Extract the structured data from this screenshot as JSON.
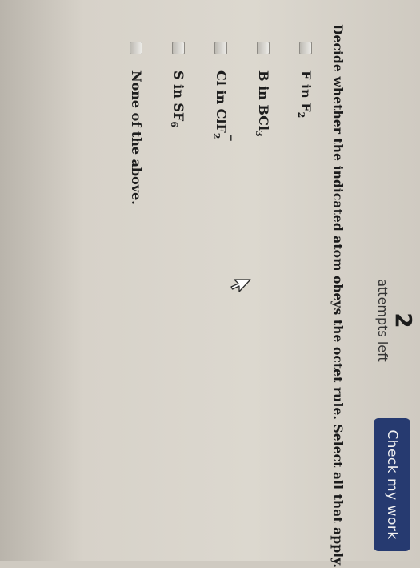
{
  "header": {
    "attempts_count": "2",
    "attempts_label": "attempts left",
    "check_button_label": "Check my work"
  },
  "question": {
    "prompt": "Decide whether the indicated atom obeys the octet rule. Select all that apply."
  },
  "options": [
    {
      "prefix": "F in F",
      "sub": "2",
      "sub_after": "",
      "sup": "",
      "checked": false
    },
    {
      "prefix": "B in BCl",
      "sub": "3",
      "sub_after": "",
      "sup": "",
      "checked": false
    },
    {
      "prefix": "Cl in ClF",
      "sub": "2",
      "sub_after": "",
      "sup": "−",
      "checked": false
    },
    {
      "prefix": "S in SF",
      "sub": "6",
      "sub_after": "",
      "sup": "",
      "checked": false
    },
    {
      "prefix": "None of the above.",
      "sub": "",
      "sub_after": "",
      "sup": "",
      "checked": false
    }
  ],
  "colors": {
    "button_bg": "#263a70",
    "button_text": "#f1f1f1",
    "screen_bg": "#d7d2c9"
  },
  "icons": {
    "cursor": "arrow-cursor-icon",
    "checkbox": "checkbox-unchecked-icon"
  }
}
